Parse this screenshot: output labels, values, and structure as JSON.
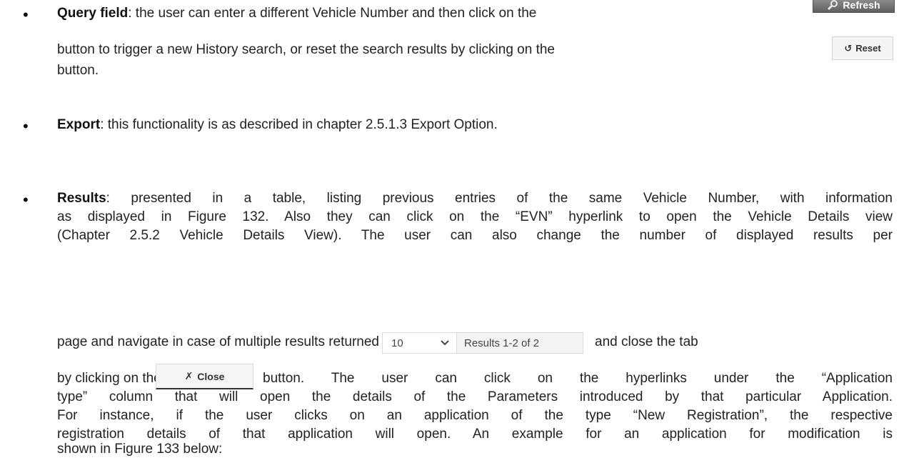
{
  "bullets": {
    "query": {
      "term": "Query field",
      "line1": ": the user can enter a different Vehicle Number and then click on the",
      "line2": "button to trigger a new History search, or reset the search results by clicking on the",
      "line3": "button."
    },
    "export": {
      "term": "Export",
      "text": ": this functionality is as described in chapter 2.5.1.3 Export Option."
    },
    "results": {
      "term": "Results",
      "line1": ": presented in a table, listing previous entries of the same Vehicle Number, with information",
      "line2": "as displayed in Figure 132. Also they can click on the “EVN” hyperlink to open the Vehicle Details view",
      "line3": "(Chapter 2.5.2 Vehicle Details View). The user can also change the number of displayed results per",
      "line4a": "page and navigate in case of multiple results returned",
      "line4b": "and close the tab",
      "line5a": "by clicking on the",
      "line5b": "button. The user can click on the hyperlinks under the “Application",
      "line6": "type” column that will open the details of the Parameters introduced by that particular Application.",
      "line7": "For instance, if the user clicks on an application of the type “New Registration”, the respective",
      "line8": "registration details of that application will open. An example for an application for modification is",
      "line9": "shown in Figure 133 below:"
    }
  },
  "buttons": {
    "refresh_label": "Refresh",
    "reset_label": "Reset",
    "close_label": "Close",
    "reset_icon": "↺",
    "close_icon": "✗"
  },
  "pager": {
    "page_size": "10",
    "results_text": "Results 1-2 of 2"
  },
  "icons": {
    "refresh": "magnifier-icon",
    "reset": "reset-icon",
    "close": "close-icon",
    "dropdown": "chevron-down-icon"
  }
}
